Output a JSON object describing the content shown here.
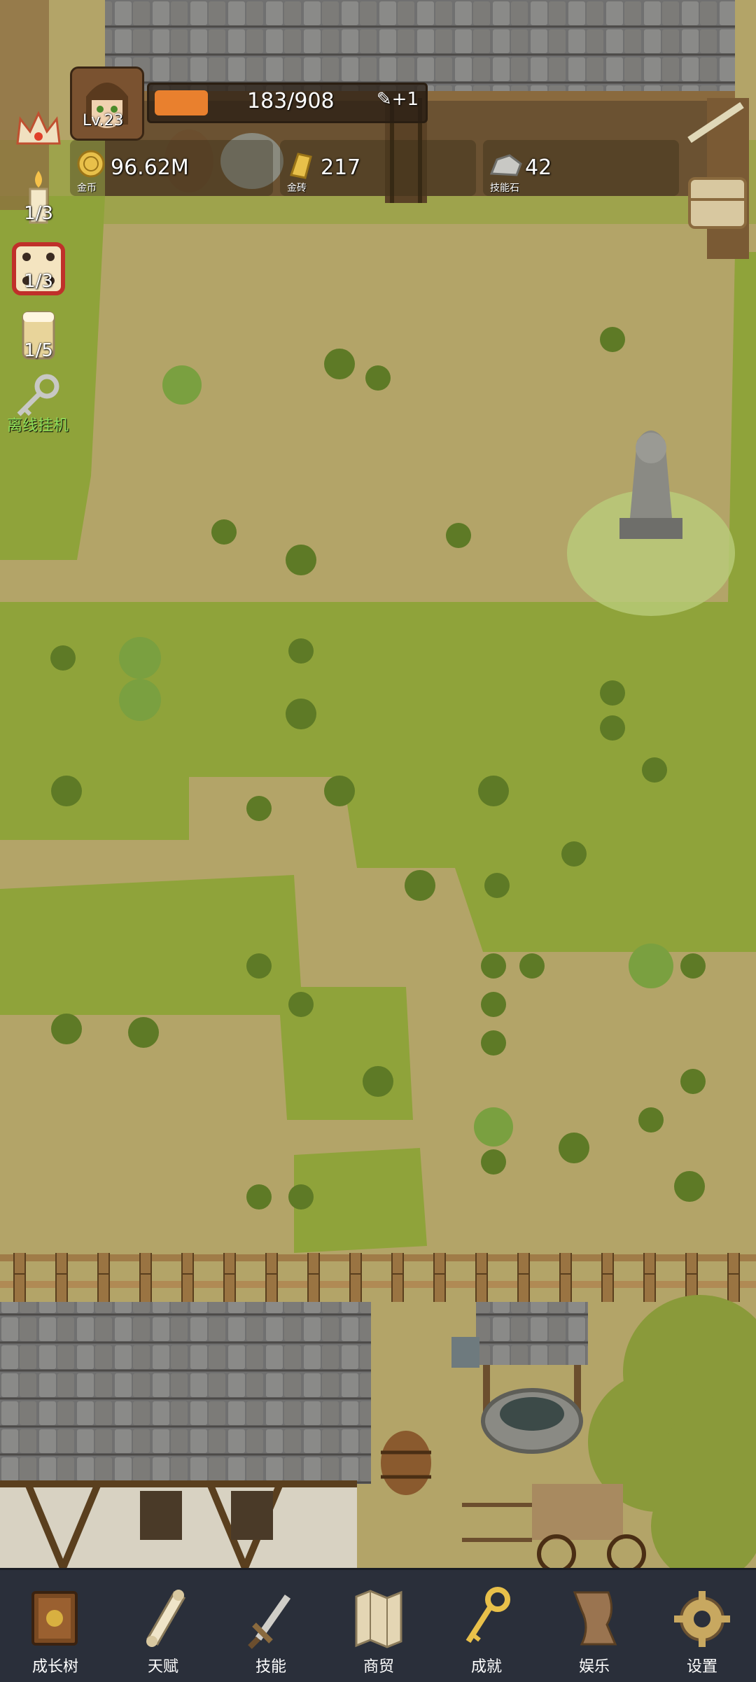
{
  "player": {
    "level": "Lv.23"
  },
  "xp": {
    "text": "183/908",
    "plus": "+1",
    "fraction": 0.2
  },
  "currencies": [
    {
      "name": "金币",
      "value": "96.62M"
    },
    {
      "name": "金砖",
      "value": "217"
    },
    {
      "name": "技能石",
      "value": "42"
    }
  ],
  "side": {
    "candle": "1/3",
    "dice": "1/3",
    "beer": "1/5",
    "afk": "离线挂机"
  },
  "nav": [
    {
      "label": "成长树",
      "icon": "book-icon"
    },
    {
      "label": "天赋",
      "icon": "scroll-icon"
    },
    {
      "label": "技能",
      "icon": "sword-icon"
    },
    {
      "label": "商贸",
      "icon": "map-icon"
    },
    {
      "label": "成就",
      "icon": "key-icon"
    },
    {
      "label": "娱乐",
      "icon": "parchment-icon"
    },
    {
      "label": "设置",
      "icon": "gear-icon"
    }
  ],
  "colors": {
    "dirt": "#b3a468",
    "grass": "#8fa33a",
    "roof": "#6e6a64",
    "wood": "#8a6a3e",
    "nav_bg": "#2a2f3a",
    "xp_fill": "#e9802e",
    "afk_text": "#8fe05a"
  }
}
